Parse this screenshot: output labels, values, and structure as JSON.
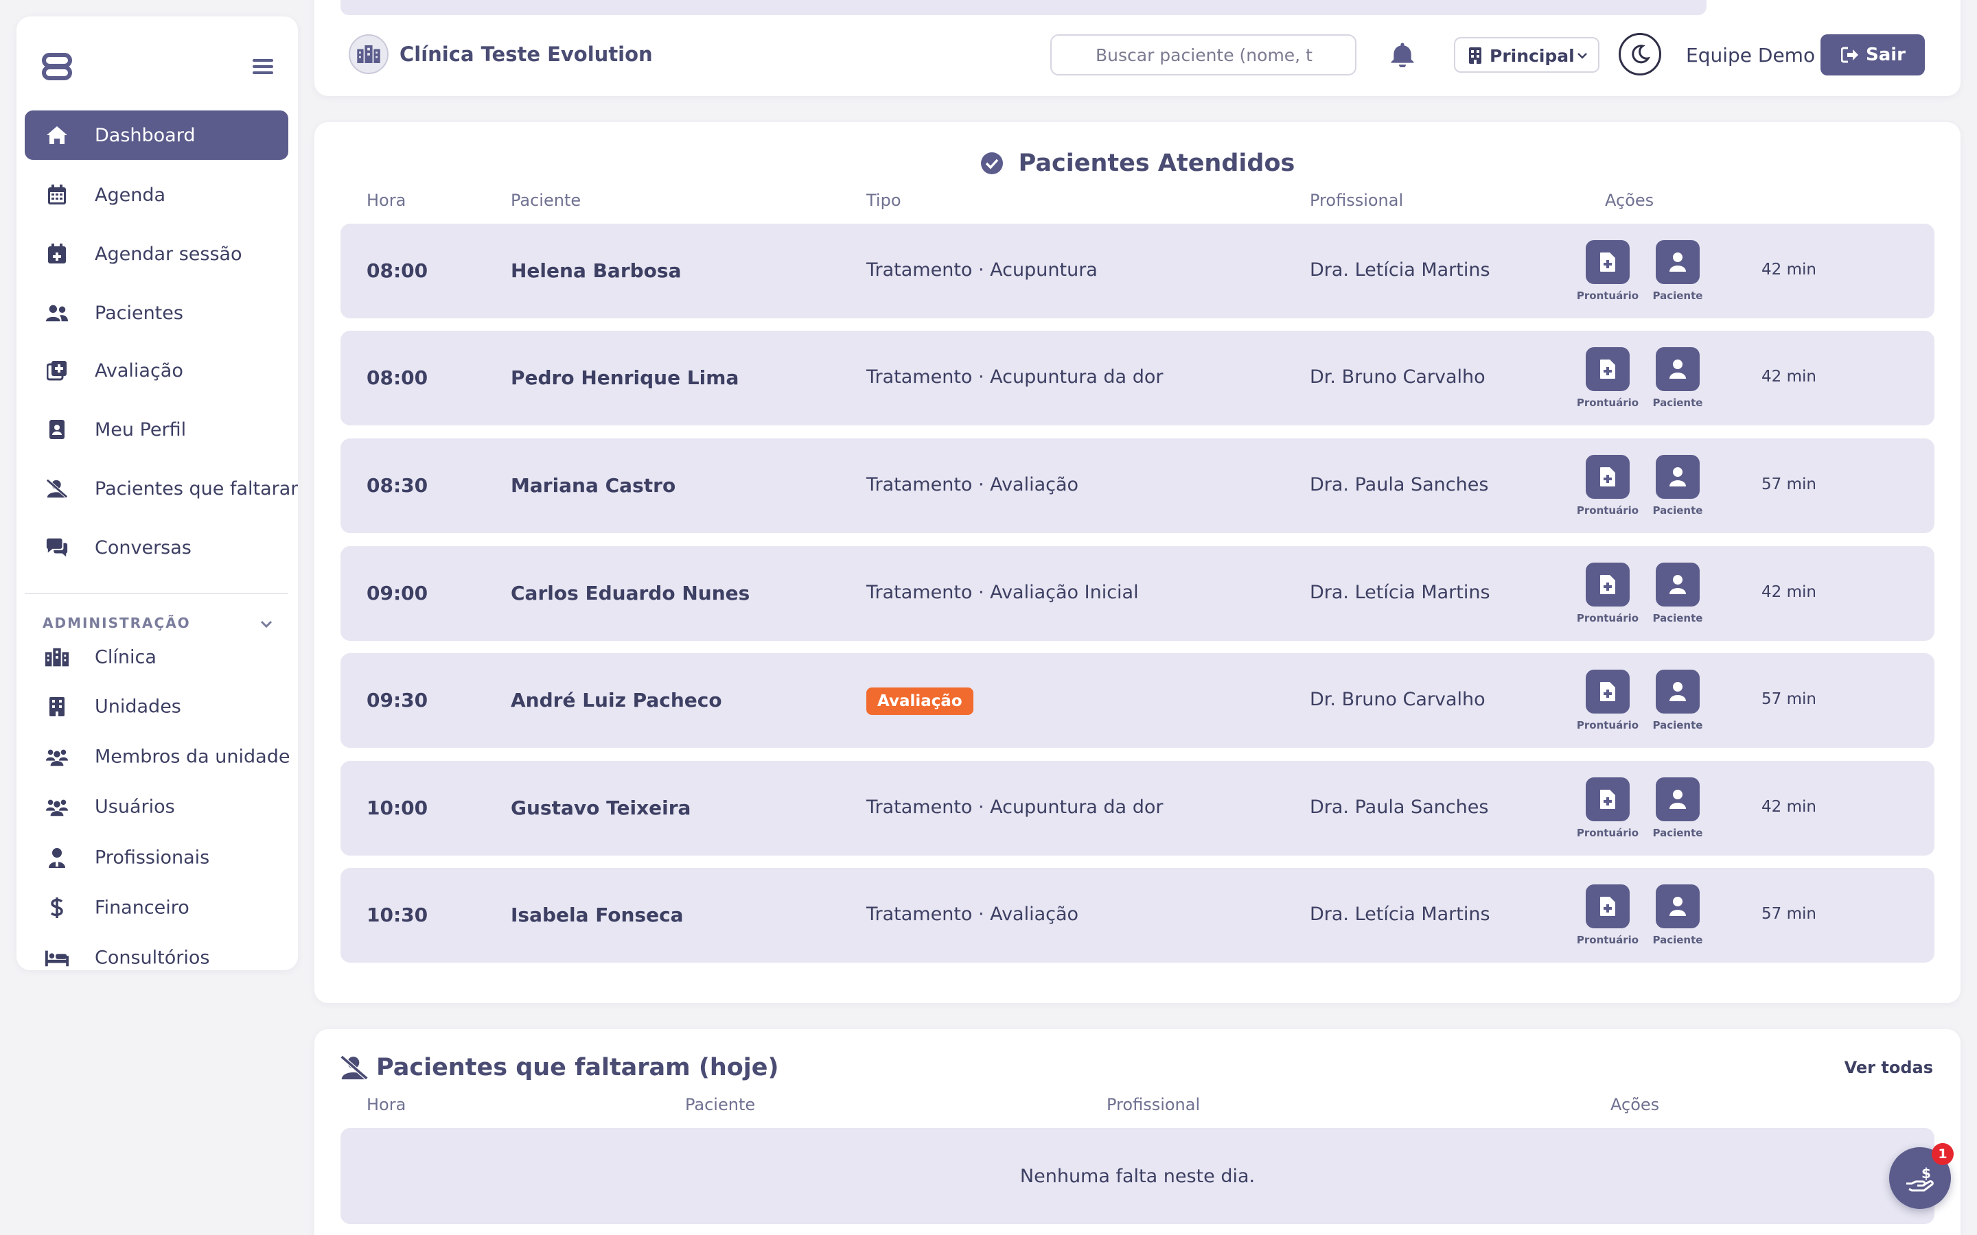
{
  "sidebar": {
    "nav": [
      {
        "label": "Dashboard",
        "icon": "home-icon",
        "active": true
      },
      {
        "label": "Agenda",
        "icon": "calendar-icon"
      },
      {
        "label": "Agendar sessão",
        "icon": "calendar-plus-icon"
      },
      {
        "label": "Pacientes",
        "icon": "users-icon"
      },
      {
        "label": "Avaliação",
        "icon": "clipboard-plus-icon"
      },
      {
        "label": "Meu Perfil",
        "icon": "id-badge-icon"
      },
      {
        "label": "Pacientes que faltaram",
        "icon": "user-slash-icon"
      },
      {
        "label": "Conversas",
        "icon": "chat-icon"
      }
    ],
    "admin_section": "ADMINISTRAÇÃO",
    "admin": [
      {
        "label": "Clínica",
        "icon": "clinic-building-icon"
      },
      {
        "label": "Unidades",
        "icon": "building-icon"
      },
      {
        "label": "Membros da unidade",
        "icon": "people-group-icon"
      },
      {
        "label": "Usuários",
        "icon": "people-group-icon"
      },
      {
        "label": "Profissionais",
        "icon": "doctor-icon"
      },
      {
        "label": "Financeiro",
        "icon": "dollar-icon"
      },
      {
        "label": "Consultórios",
        "icon": "bed-icon"
      }
    ]
  },
  "header": {
    "clinic_name": "Clínica Teste Evolution",
    "search_placeholder": "Buscar paciente (nome, t",
    "unit": "Principal",
    "user": "Equipe Demo",
    "logout": "Sair"
  },
  "attended": {
    "title": "Pacientes Atendidos",
    "columns": [
      "Hora",
      "Paciente",
      "Tipo",
      "Profissional",
      "Ações"
    ],
    "action_labels": [
      "Prontuário",
      "Paciente"
    ],
    "rows": [
      {
        "time": "08:00",
        "patient": "Helena Barbosa",
        "type": "Tratamento · Acupuntura",
        "professional": "Dra. Letícia Martins",
        "duration": "42 min"
      },
      {
        "time": "08:00",
        "patient": "Pedro Henrique Lima",
        "type": "Tratamento · Acupuntura da dor",
        "professional": "Dr. Bruno Carvalho",
        "duration": "42 min"
      },
      {
        "time": "08:30",
        "patient": "Mariana Castro",
        "type": "Tratamento · Avaliação",
        "professional": "Dra. Paula Sanches",
        "duration": "57 min"
      },
      {
        "time": "09:00",
        "patient": "Carlos Eduardo Nunes",
        "type": "Tratamento · Avaliação Inicial",
        "professional": "Dra. Letícia Martins",
        "duration": "42 min"
      },
      {
        "time": "09:30",
        "patient": "André Luiz Pacheco",
        "type": "",
        "badge": "Avaliação",
        "professional": "Dr. Bruno Carvalho",
        "duration": "57 min"
      },
      {
        "time": "10:00",
        "patient": "Gustavo Teixeira",
        "type": "Tratamento · Acupuntura da dor",
        "professional": "Dra. Paula Sanches",
        "duration": "42 min"
      },
      {
        "time": "10:30",
        "patient": "Isabela Fonseca",
        "type": "Tratamento · Avaliação",
        "professional": "Dra. Letícia Martins",
        "duration": "57 min"
      }
    ]
  },
  "missed": {
    "title": "Pacientes que faltaram (hoje)",
    "view_all": "Ver todas",
    "columns": [
      "Hora",
      "Paciente",
      "Profissional",
      "Ações"
    ],
    "empty": "Nenhuma falta neste dia."
  },
  "fab": {
    "badge": "1",
    "icon": "hand-dollar-icon"
  },
  "colors": {
    "accent": "#5b5c8c",
    "row_bg": "#e7e6f2",
    "badge_orange": "#f26b2e",
    "notification_red": "#e5262e"
  }
}
